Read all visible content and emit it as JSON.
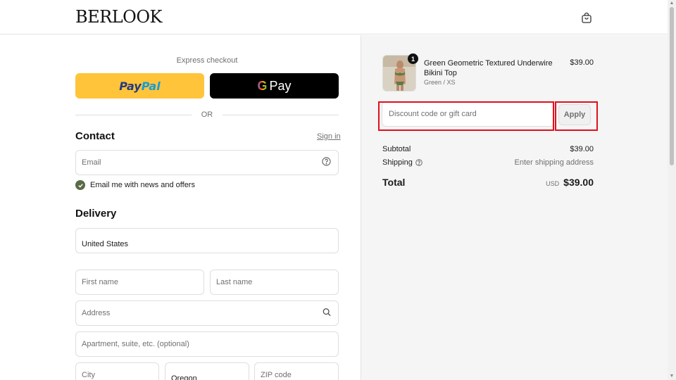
{
  "brand": {
    "logo_text": "BERLOOK"
  },
  "header": {
    "cart_icon": "shopping-bag-icon"
  },
  "express": {
    "label": "Express checkout",
    "paypal_part1": "Pay",
    "paypal_part2": "Pal",
    "gpay_g": "G",
    "gpay_text": "Pay",
    "or_label": "OR"
  },
  "contact": {
    "title": "Contact",
    "signin_label": "Sign in",
    "email_placeholder": "Email",
    "newsletter_label": "Email me with news and offers"
  },
  "delivery": {
    "title": "Delivery",
    "country_value": "United States",
    "first_name_placeholder": "First name",
    "last_name_placeholder": "Last name",
    "address_placeholder": "Address",
    "apartment_placeholder": "Apartment, suite, etc. (optional)",
    "city_placeholder": "City",
    "state_value": "Oregon",
    "zip_placeholder": "ZIP code"
  },
  "order": {
    "quantity": "1",
    "product_name": "Green Geometric Textured Underwire Bikini Top",
    "product_variant": "Green / XS",
    "product_price": "$39.00",
    "discount_placeholder": "Discount code or gift card",
    "apply_label": "Apply",
    "subtotal_label": "Subtotal",
    "subtotal_value": "$39.00",
    "shipping_label": "Shipping",
    "shipping_value": "Enter shipping address",
    "total_label": "Total",
    "currency": "USD",
    "total_value": "$39.00"
  },
  "colors": {
    "paypal_bg": "#ffc439",
    "gpay_bg": "#000000",
    "checkbox": "#5a6b48",
    "highlight": "#e0101c"
  }
}
